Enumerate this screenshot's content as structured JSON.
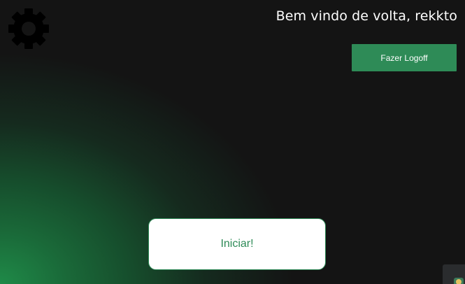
{
  "header": {
    "welcome_text": "Bem vindo de volta, rekkto"
  },
  "settings": {
    "icon": "gear-icon"
  },
  "actions": {
    "logoff_label": "Fazer Logoff",
    "start_label": "Iniciar!"
  },
  "widgets": {
    "corner_icon": "app-tray-icon"
  },
  "colors": {
    "background": "#141414",
    "accent_green": "#2e8b57",
    "glow_green": "#1f8a48",
    "text_light": "#ffffff",
    "gear": "#000000"
  }
}
